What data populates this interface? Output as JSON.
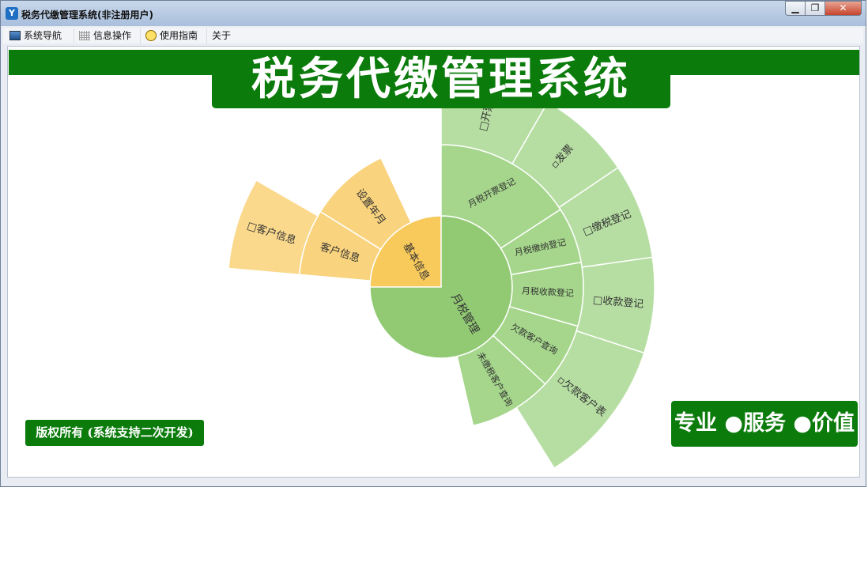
{
  "window": {
    "title": "税务代缴管理系统(非注册用户)",
    "app_icon_letter": "Y",
    "min_glyph": "▁",
    "max_glyph": "❐",
    "close_glyph": "✕"
  },
  "menu": {
    "items": [
      {
        "label": "系统导航",
        "icon": "monitor-icon"
      },
      {
        "label": "信息操作",
        "icon": "grid-icon"
      },
      {
        "label": "使用指南",
        "icon": "bulb-icon"
      },
      {
        "label": "关于",
        "icon": ""
      }
    ]
  },
  "banner": {
    "title": "税务代缴管理系统"
  },
  "footer": {
    "copyright": "版权所有 (系统支持二次开发)",
    "slogan": "专业 ●服务 ●价值"
  },
  "sunburst": {
    "colors": {
      "orange_inner": "#f8c95b",
      "orange_mid": "#f9d37d",
      "orange_outer": "#fad98d",
      "green_inner": "#92ca74",
      "green_mid": "#a5d68b",
      "green_outer": "#b6dea2",
      "banner_green": "#0b7b0b"
    },
    "center_label": "月税管理",
    "nodes": [
      {
        "label": "基本信息",
        "ring": 1,
        "group": "orange"
      },
      {
        "label": "客户信息",
        "ring": 2,
        "group": "orange"
      },
      {
        "label": "设置年月",
        "ring": 2,
        "group": "orange"
      },
      {
        "label": "□客户信息",
        "ring": 3,
        "group": "orange"
      },
      {
        "label": "月税开票登记",
        "ring": 2,
        "group": "green"
      },
      {
        "label": "月税缴纳登记",
        "ring": 2,
        "group": "green"
      },
      {
        "label": "月税收款登记",
        "ring": 2,
        "group": "green"
      },
      {
        "label": "欠款客户查询",
        "ring": 2,
        "group": "green"
      },
      {
        "label": "未缴税客户查询",
        "ring": 2,
        "group": "green"
      },
      {
        "label": "□开票登",
        "ring": 3,
        "group": "green"
      },
      {
        "label": "▫发票",
        "ring": 3,
        "group": "green"
      },
      {
        "label": "□缴税登记",
        "ring": 3,
        "group": "green"
      },
      {
        "label": "□收款登记",
        "ring": 3,
        "group": "green"
      },
      {
        "label": "▫欠款客户表",
        "ring": 3,
        "group": "green"
      }
    ]
  }
}
